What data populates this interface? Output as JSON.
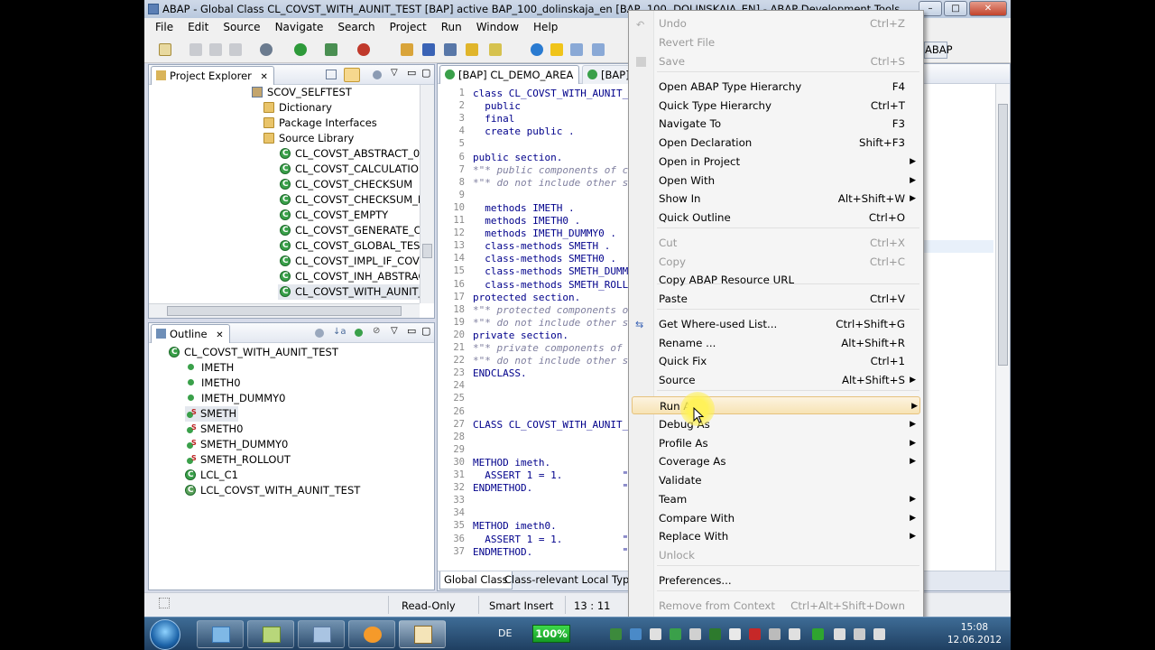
{
  "window": {
    "title": "ABAP - Global Class CL_COVST_WITH_AUNIT_TEST [BAP] active BAP_100_dolinskaja_en [BAP, 100, DOLINSKAJA_EN] - ABAP Development Tools",
    "buttons": [
      "–",
      "□",
      "✕"
    ]
  },
  "menubar": [
    "File",
    "Edit",
    "Source",
    "Navigate",
    "Search",
    "Project",
    "Run",
    "Window",
    "Help"
  ],
  "perspective_label": "ABAP",
  "project_explorer": {
    "tab": "Project Explorer",
    "items": [
      {
        "label": "SCOV_SELFTEST",
        "icon": "package-icon"
      },
      {
        "label": "Dictionary",
        "icon": "folder-icon"
      },
      {
        "label": "Package Interfaces",
        "icon": "folder-icon"
      },
      {
        "label": "Source Library",
        "icon": "folder-icon"
      },
      {
        "label": "CL_COVST_ABSTRACT_0",
        "icon": "class-icon"
      },
      {
        "label": "CL_COVST_CALCULATION",
        "icon": "class-icon"
      },
      {
        "label": "CL_COVST_CHECKSUM",
        "icon": "class-icon"
      },
      {
        "label": "CL_COVST_CHECKSUM_M",
        "icon": "class-icon"
      },
      {
        "label": "CL_COVST_EMPTY",
        "icon": "class-icon"
      },
      {
        "label": "CL_COVST_GENERATE_CO",
        "icon": "class-icon"
      },
      {
        "label": "CL_COVST_GLOBAL_TEST_",
        "icon": "class-icon"
      },
      {
        "label": "CL_COVST_IMPL_IF_COVST",
        "icon": "class-icon"
      },
      {
        "label": "CL_COVST_INH_ABSTRACT",
        "icon": "class-icon"
      },
      {
        "label": "CL_COVST_WITH_AUNIT_T",
        "icon": "class-icon"
      }
    ]
  },
  "outline": {
    "tab": "Outline",
    "root": "CL_COVST_WITH_AUNIT_TEST",
    "items": [
      {
        "label": "IMETH",
        "icon": "method-icon"
      },
      {
        "label": "IMETH0",
        "icon": "method-icon"
      },
      {
        "label": "IMETH_DUMMY0",
        "icon": "method-icon"
      },
      {
        "label": "SMETH",
        "icon": "static-method-icon"
      },
      {
        "label": "SMETH0",
        "icon": "static-method-icon"
      },
      {
        "label": "SMETH_DUMMY0",
        "icon": "static-method-icon"
      },
      {
        "label": "SMETH_ROLLOUT",
        "icon": "static-method-icon"
      },
      {
        "label": "LCL_C1",
        "icon": "local-class-icon"
      },
      {
        "label": "LCL_COVST_WITH_AUNIT_TEST",
        "icon": "test-class-icon"
      }
    ]
  },
  "editor": {
    "tabs": [
      "[BAP] CL_DEMO_AREA",
      "[BAP]"
    ],
    "bottom_tabs": [
      "Global Class",
      "Class-relevant Local Types"
    ],
    "lines": [
      {
        "n": "1",
        "text": "class CL_COVST_WITH_AUNIT_T"
      },
      {
        "n": "2",
        "text": "  public"
      },
      {
        "n": "3",
        "text": "  final"
      },
      {
        "n": "4",
        "text": "  create public ."
      },
      {
        "n": "5",
        "text": ""
      },
      {
        "n": "6",
        "text": "public section."
      },
      {
        "n": "7",
        "text": "*\"* public components of c"
      },
      {
        "n": "8",
        "text": "*\"* do not include other so"
      },
      {
        "n": "9",
        "text": ""
      },
      {
        "n": "10",
        "text": "  methods IMETH ."
      },
      {
        "n": "11",
        "text": "  methods IMETH0 ."
      },
      {
        "n": "12",
        "text": "  methods IMETH_DUMMY0 ."
      },
      {
        "n": "13",
        "text": "  class-methods SMETH ."
      },
      {
        "n": "14",
        "text": "  class-methods SMETH0 ."
      },
      {
        "n": "15",
        "text": "  class-methods SMETH_DUMMY"
      },
      {
        "n": "16",
        "text": "  class-methods SMETH_ROLLO"
      },
      {
        "n": "17",
        "text": "protected section."
      },
      {
        "n": "18",
        "text": "*\"* protected components o"
      },
      {
        "n": "19",
        "text": "*\"* do not include other s"
      },
      {
        "n": "20",
        "text": "private section."
      },
      {
        "n": "21",
        "text": "*\"* private components of "
      },
      {
        "n": "22",
        "text": "*\"* do not include other so"
      },
      {
        "n": "23",
        "text": "ENDCLASS."
      },
      {
        "n": "24",
        "text": ""
      },
      {
        "n": "25",
        "text": ""
      },
      {
        "n": "26",
        "text": ""
      },
      {
        "n": "27",
        "text": "CLASS CL_COVST_WITH_AUNIT_T"
      },
      {
        "n": "28",
        "text": ""
      },
      {
        "n": "29",
        "text": ""
      },
      {
        "n": "30",
        "text": "METHOD imeth."
      },
      {
        "n": "31",
        "text": "  ASSERT 1 = 1.          \""
      },
      {
        "n": "32",
        "text": "ENDMETHOD.               \""
      },
      {
        "n": "33",
        "text": ""
      },
      {
        "n": "34",
        "text": ""
      },
      {
        "n": "35",
        "text": "METHOD imeth0."
      },
      {
        "n": "36",
        "text": "  ASSERT 1 = 1.          \""
      },
      {
        "n": "37",
        "text": "ENDMETHOD.               \""
      }
    ]
  },
  "context_menu": {
    "items": [
      {
        "label": "Undo",
        "shortcut": "Ctrl+Z",
        "disabled": true
      },
      {
        "label": "Revert File",
        "shortcut": "",
        "disabled": true
      },
      {
        "label": "Save",
        "shortcut": "Ctrl+S",
        "disabled": true
      },
      {
        "label": "Open ABAP Type Hierarchy",
        "shortcut": "F4"
      },
      {
        "label": "Quick Type Hierarchy",
        "shortcut": "Ctrl+T"
      },
      {
        "label": "Navigate To",
        "shortcut": "F3"
      },
      {
        "label": "Open Declaration",
        "shortcut": "Shift+F3"
      },
      {
        "label": "Open in Project",
        "submenu": true
      },
      {
        "label": "Open With",
        "submenu": true
      },
      {
        "label": "Show In",
        "shortcut": "Alt+Shift+W",
        "submenu": true
      },
      {
        "label": "Quick Outline",
        "shortcut": "Ctrl+O"
      },
      {
        "label": "Cut",
        "shortcut": "Ctrl+X",
        "disabled": true
      },
      {
        "label": "Copy",
        "shortcut": "Ctrl+C",
        "disabled": true
      },
      {
        "label": "Copy ABAP Resource URL",
        "shortcut": ""
      },
      {
        "label": "Paste",
        "shortcut": "Ctrl+V"
      },
      {
        "label": "Get Where-used List...",
        "shortcut": "Ctrl+Shift+G"
      },
      {
        "label": "Rename ...",
        "shortcut": "Alt+Shift+R"
      },
      {
        "label": "Quick Fix",
        "shortcut": "Ctrl+1"
      },
      {
        "label": "Source",
        "shortcut": "Alt+Shift+S",
        "submenu": true
      },
      {
        "label": "Run As",
        "submenu": true,
        "highlighted": true
      },
      {
        "label": "Debug As",
        "submenu": true
      },
      {
        "label": "Profile As",
        "submenu": true
      },
      {
        "label": "Coverage As",
        "submenu": true
      },
      {
        "label": "Validate"
      },
      {
        "label": "Team",
        "submenu": true
      },
      {
        "label": "Compare With",
        "submenu": true
      },
      {
        "label": "Replace With",
        "submenu": true
      },
      {
        "label": "Unlock",
        "disabled": true
      },
      {
        "label": "Preferences..."
      },
      {
        "label": "Remove from Context",
        "shortcut": "Ctrl+Alt+Shift+Down",
        "disabled": true
      }
    ]
  },
  "statusbar": {
    "mode": "Read-Only",
    "insert": "Smart Insert",
    "position": "13 : 11"
  },
  "taskbar": {
    "lang": "DE",
    "battery": "100%",
    "time": "15:08",
    "date": "12.06.2012"
  }
}
